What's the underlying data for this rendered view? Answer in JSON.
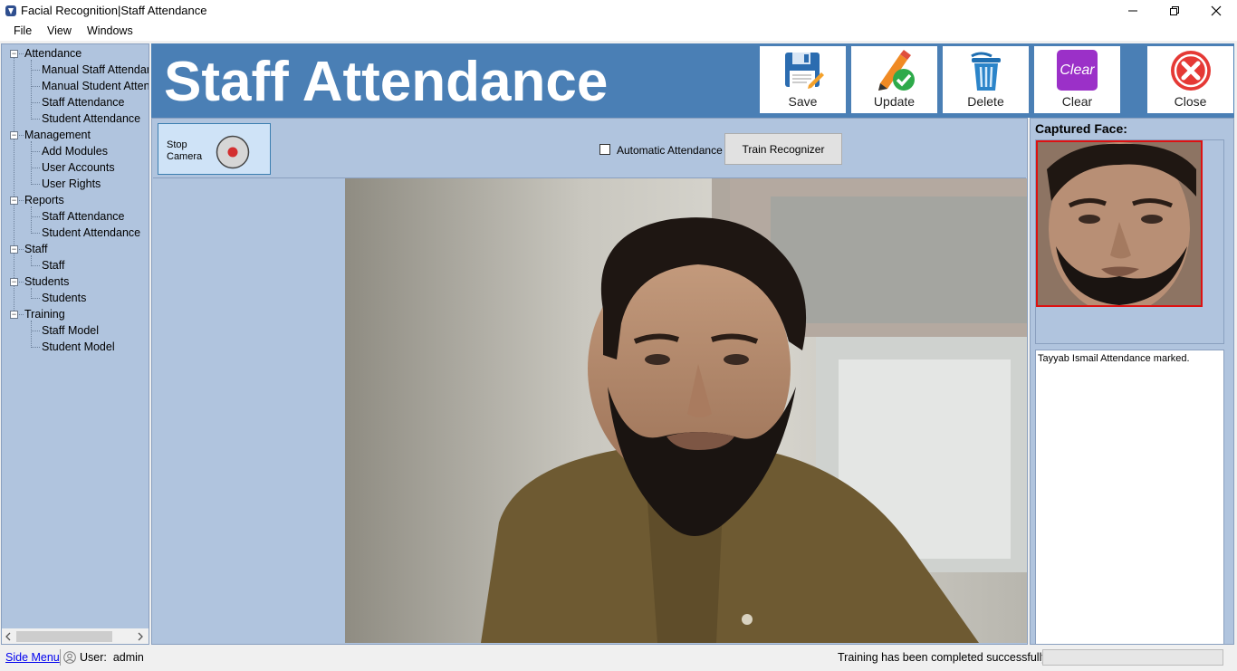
{
  "window": {
    "title": "Facial Recognition|Staff Attendance"
  },
  "menu": [
    "File",
    "View",
    "Windows"
  ],
  "sidebar": {
    "groups": [
      {
        "label": "Attendance",
        "items": [
          "Manual Staff Attendan",
          "Manual Student Attend",
          "Staff Attendance",
          "Student Attendance"
        ]
      },
      {
        "label": "Management",
        "items": [
          "Add Modules",
          "User Accounts",
          "User Rights"
        ]
      },
      {
        "label": "Reports",
        "items": [
          "Staff Attendance",
          "Student Attendance"
        ]
      },
      {
        "label": "Staff",
        "items": [
          "Staff"
        ]
      },
      {
        "label": "Students",
        "items": [
          "Students"
        ]
      },
      {
        "label": "Training",
        "items": [
          "Staff Model",
          "Student Model"
        ]
      }
    ]
  },
  "header": {
    "title": "Staff Attendance",
    "buttons": {
      "save": "Save",
      "update": "Update",
      "delete": "Delete",
      "clear": "Clear",
      "clear_icon_text": "Clear",
      "close": "Close"
    }
  },
  "controls": {
    "stop_camera_line1": "Stop",
    "stop_camera_line2": "Camera",
    "automatic_attendance": "Automatic Attendance",
    "automatic_attendance_checked": false,
    "train_recognizer": "Train Recognizer"
  },
  "right_panel": {
    "captured_face_label": "Captured Face:",
    "log": "Tayyab Ismail Attendance marked."
  },
  "status": {
    "side_menu": "Side Menu",
    "user_label": "User:",
    "user_name": "admin",
    "message": "Training has been completed successfully!",
    "progress": 0
  },
  "colors": {
    "header_bg": "#4a7fb5",
    "panel_bg": "#b0c4de",
    "record_dot": "#d32f2f",
    "clear_icon": "#9b30c8",
    "close_icon": "#e53935",
    "face_border": "#dd1111"
  },
  "icons": [
    "app-icon",
    "minimize-icon",
    "restore-icon",
    "close-window-icon",
    "floppy-save-icon",
    "update-pencil-check-icon",
    "trash-icon",
    "clear-icon",
    "close-x-icon",
    "record-icon",
    "user-icon"
  ]
}
